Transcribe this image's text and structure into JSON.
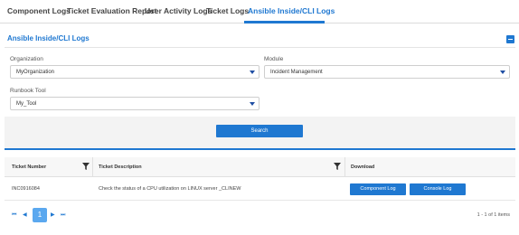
{
  "tabs": {
    "component_logs": "Component Logs",
    "ticket_evaluation_report": "Ticket Evaluation Report",
    "user_activity_logs": "User Activity Logs",
    "ticket_logs": "Ticket Logs",
    "ansible_cli_logs": "Ansible Inside/CLI Logs",
    "active": "ansible_cli_logs"
  },
  "panel": {
    "title": "Ansible Inside/CLI Logs",
    "organization_label": "Organization",
    "organization_value": "MyOrganization",
    "module_label": "Module",
    "module_value": "Incident Management",
    "runbook_label": "Runbook Tool",
    "runbook_value": "My_Tool",
    "search_label": "Search"
  },
  "grid": {
    "columns": {
      "ticket_number": "Ticket Number",
      "ticket_description": "Ticket Description",
      "download": "Download"
    },
    "rows": [
      {
        "ticket_number": "INC0916084",
        "ticket_description": "Check the status of a CPU utilization on LINUX server _CLINEW",
        "component_log_label": "Component Log",
        "console_log_label": "Console Log"
      }
    ]
  },
  "pager": {
    "first": "⏮",
    "prev": "◀",
    "next": "▶",
    "last": "⏭",
    "current_page": "1",
    "info": "1 - 1 of 1 items"
  },
  "colors": {
    "accent": "#1f78d1",
    "pager_active": "#5ba8ef"
  }
}
